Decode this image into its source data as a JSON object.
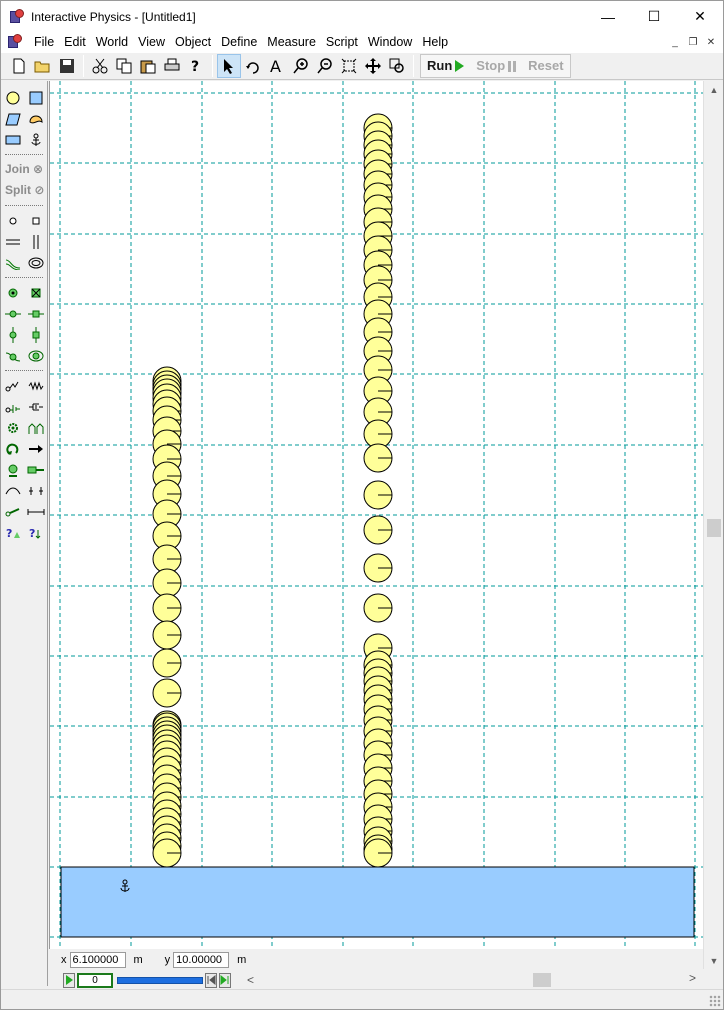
{
  "window": {
    "title": "Interactive Physics - [Untitled1]",
    "minimize": "—",
    "maximize": "☐",
    "close": "✕"
  },
  "menu": {
    "items": [
      "File",
      "Edit",
      "World",
      "View",
      "Object",
      "Define",
      "Measure",
      "Script",
      "Window",
      "Help"
    ],
    "mdi_minimize": "_",
    "mdi_restore": "❐",
    "mdi_close": "✕"
  },
  "toolbar": {
    "file_icons": [
      "new-icon",
      "open-icon",
      "save-icon"
    ],
    "edit_icons": [
      "cut-icon",
      "copy-icon",
      "paste-icon",
      "print-icon",
      "help-icon"
    ],
    "tool_icons": [
      "arrow-pointer-icon",
      "rotate-icon",
      "text-icon",
      "zoom-in-icon",
      "zoom-out-icon",
      "zoom-fit-icon",
      "pan-icon",
      "zoom-object-icon"
    ],
    "run_label": "Run",
    "stop_label": "Stop",
    "reset_label": "Reset",
    "active_tool": "arrow-pointer-icon"
  },
  "palette": {
    "join_label": "Join",
    "split_label": "Split"
  },
  "coords": {
    "x_label": "x",
    "x_value": "6.100000",
    "x_unit": "m",
    "y_label": "y",
    "y_value": "10.00000",
    "y_unit": "m"
  },
  "player": {
    "frame": "0"
  },
  "scene": {
    "ball_color": "#ffff99",
    "ground_color": "#99ccff",
    "grid_color": "#009999",
    "anchor_icon": "anchor-icon"
  }
}
